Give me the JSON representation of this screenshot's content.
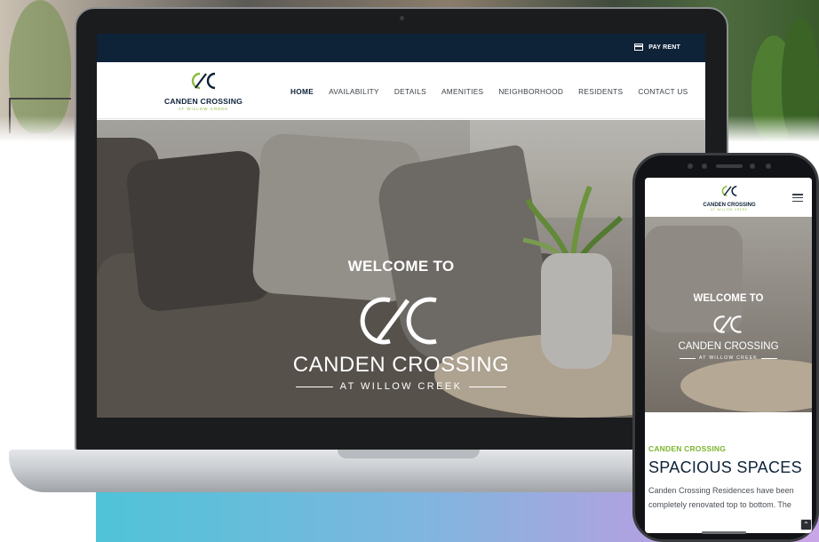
{
  "desktop": {
    "topbar": {
      "pay_rent_label": "PAY RENT"
    },
    "logo": {
      "name": "CANDEN CROSSING",
      "sub": "AT WILLOW CREEK"
    },
    "nav": [
      {
        "label": "HOME",
        "active": true
      },
      {
        "label": "AVAILABILITY"
      },
      {
        "label": "DETAILS"
      },
      {
        "label": "AMENITIES"
      },
      {
        "label": "NEIGHBORHOOD"
      },
      {
        "label": "RESIDENTS"
      },
      {
        "label": "CONTACT US"
      }
    ],
    "hero": {
      "welcome": "WELCOME TO",
      "name": "CANDEN CROSSING",
      "sub": "AT WILLOW CREEK"
    }
  },
  "mobile": {
    "logo": {
      "name": "CANDEN CROSSING",
      "sub": "AT WILLOW CREEK"
    },
    "hero": {
      "welcome": "WELCOME TO",
      "name": "CANDEN CROSSING",
      "sub": "AT WILLOW CREEK"
    },
    "section": {
      "eyebrow": "CANDEN CROSSING",
      "heading": "SPACIOUS SPACES",
      "body": "Canden Crossing Residences have been completely renovated top to bottom. The"
    }
  },
  "colors": {
    "navy": "#0e2238",
    "green": "#8dbb3d",
    "accent_green": "#7ab42e"
  },
  "icons": [
    "credit-card-icon",
    "hamburger-menu-icon",
    "chevron-up-icon",
    "cc-logo-icon"
  ]
}
